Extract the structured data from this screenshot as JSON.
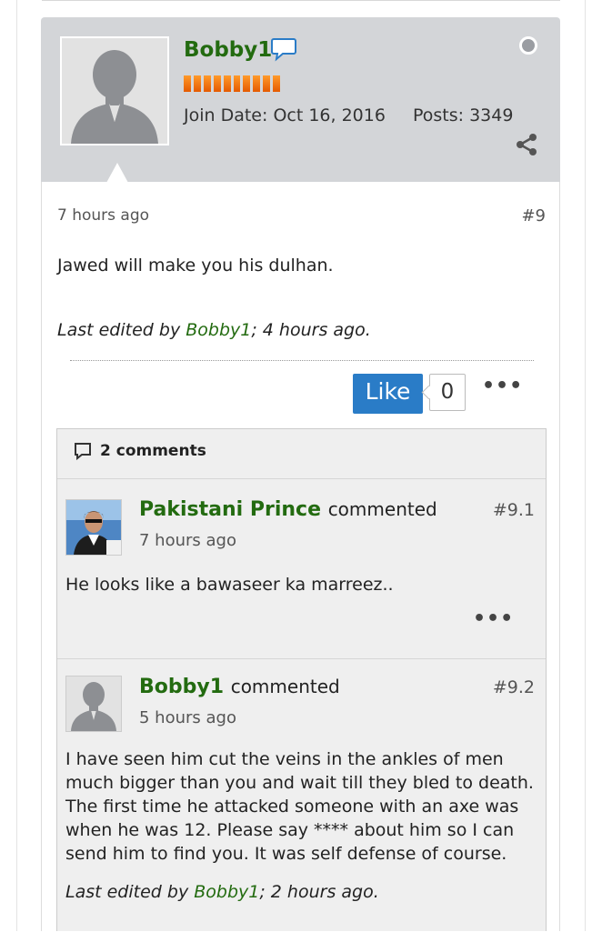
{
  "post": {
    "username": "Bobby1",
    "join_date": "Join Date: Oct 16, 2016",
    "posts": "Posts: 3349",
    "time": "7 hours ago",
    "number": "#9",
    "content": "Jawed will make you his dulhan.",
    "edited_prefix": "Last edited by ",
    "edited_by": "Bobby1",
    "edited_suffix": "; 4 hours ago.",
    "like_label": "Like",
    "like_count": "0",
    "more_label": "•••"
  },
  "comments": {
    "count_label": "2 comments",
    "items": [
      {
        "name": "Pakistani Prince",
        "verb": "commented",
        "number": "#9.1",
        "time": "7 hours ago",
        "text": "He looks like a bawaseer ka marreez..",
        "more_label": "•••"
      },
      {
        "name": "Bobby1",
        "verb": "commented",
        "number": "#9.2",
        "time": "5 hours ago",
        "text": "I have seen him cut the veins in the ankles of men much bigger than you and wait till they bled to death. The first time he attacked someone with an axe was when he was 12. Please say **** about him so I can send him to find you. It was self defense of course.",
        "edited_prefix": "Last edited by ",
        "edited_by": "Bobby1",
        "edited_suffix": "; 2 hours ago."
      }
    ]
  },
  "colors": {
    "username_green": "#236b10",
    "like_blue": "#2a7cc7",
    "header_gray": "#d3d5d8",
    "rep_orange": "#ff7a10"
  },
  "icons": [
    "chat-bubble-icon",
    "status-offline-icon",
    "share-icon",
    "comment-icon",
    "avatar-placeholder-icon"
  ]
}
